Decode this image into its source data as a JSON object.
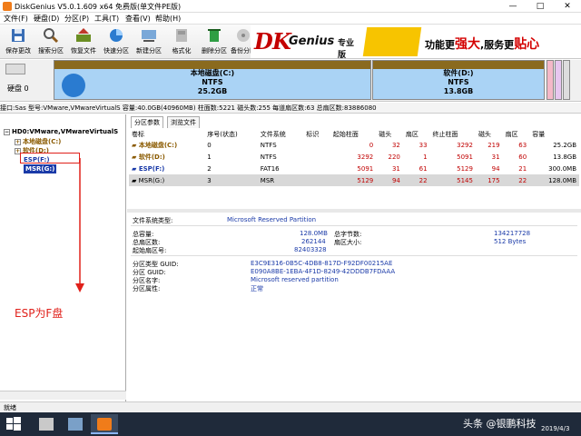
{
  "window": {
    "title": "DiskGenius V5.0.1.609 x64 免费版(单文件PE版)",
    "min": "—",
    "max": "□",
    "close": "✕"
  },
  "menu": [
    "文件(F)",
    "硬盘(D)",
    "分区(P)",
    "工具(T)",
    "查看(V)",
    "帮助(H)"
  ],
  "toolbar": {
    "items": [
      {
        "label": "保存更改",
        "icon": "save-icon"
      },
      {
        "label": "搜索分区",
        "icon": "search-icon"
      },
      {
        "label": "恢复文件",
        "icon": "recover-icon"
      },
      {
        "label": "快速分区",
        "icon": "quick-partition-icon"
      },
      {
        "label": "新建分区",
        "icon": "new-partition-icon"
      },
      {
        "label": "格式化",
        "icon": "format-icon"
      },
      {
        "label": "删除分区",
        "icon": "delete-icon"
      },
      {
        "label": "备份分区",
        "icon": "backup-icon"
      }
    ]
  },
  "banner": {
    "brand_a": "D",
    "brand_b": "K",
    "brand_name": "Genius",
    "brand_tag": "专业版",
    "slogan_a": "功能更",
    "slogan_b": "强大",
    "slogan_c": ",服务更",
    "slogan_d": "贴心"
  },
  "disk_map": {
    "label": "硬盘 0",
    "partitions": [
      {
        "name": "本地磁盘(C:)",
        "fs": "NTFS",
        "size": "25.2GB"
      },
      {
        "name": "软件(D:)",
        "fs": "NTFS",
        "size": "13.8GB"
      }
    ]
  },
  "info_line": "接口:Sas  型号:VMware,VMwareVirtualS  容量:40.0GB(40960MB)  柱面数:5221  磁头数:255  每道扇区数:63  总扇区数:83886080",
  "tree": {
    "disk": "HD0:VMware,VMwareVirtualS",
    "nodes": [
      "本地磁盘(C:)",
      "软件(D:)",
      "ESP(F:)",
      "MSR(G:)"
    ]
  },
  "tabs": [
    "分区参数",
    "浏览文件"
  ],
  "table": {
    "headers": [
      "卷标",
      "序号(状态)",
      "文件系统",
      "标识",
      "起始柱面",
      "磁头",
      "扇区",
      "终止柱面",
      "磁头",
      "扇区",
      "容量"
    ],
    "rows": [
      [
        "本地磁盘(C:)",
        "0",
        "NTFS",
        "",
        "0",
        "32",
        "33",
        "3292",
        "219",
        "63",
        "25.2GB"
      ],
      [
        "软件(D:)",
        "1",
        "NTFS",
        "",
        "3292",
        "220",
        "1",
        "5091",
        "31",
        "60",
        "13.8GB"
      ],
      [
        "ESP(F:)",
        "2",
        "FAT16",
        "",
        "5091",
        "31",
        "61",
        "5129",
        "94",
        "21",
        "300.0MB"
      ],
      [
        "MSR(G:)",
        "3",
        "MSR",
        "",
        "5129",
        "94",
        "22",
        "5145",
        "175",
        "22",
        "128.0MB"
      ]
    ]
  },
  "details": {
    "fs_type_label": "文件系统类型:",
    "fs_type_value": "Microsoft Reserved Partition",
    "total_cap_label": "总容量:",
    "total_cap_value": "128.0MB",
    "total_bytes_label": "总字节数:",
    "total_bytes_value": "134217728",
    "total_sec_label": "总扇区数:",
    "total_sec_value": "262144",
    "sec_size_label": "扇区大小:",
    "sec_size_value": "512 Bytes",
    "start_sec_label": "起始扇区号:",
    "start_sec_value": "82403328",
    "type_guid_label": "分区类型 GUID:",
    "type_guid_value": "E3C9E316-0B5C-4DB8-817D-F92DF00215AE",
    "guid_label": "分区 GUID:",
    "guid_value": "E090A8BE-1EBA-4F1D-8249-42DDDB7FDAAA",
    "name_label": "分区名字:",
    "name_value": "Microsoft reserved partition",
    "attr_label": "分区属性:",
    "attr_value": "正常"
  },
  "annotation": "ESP为F盘",
  "status": "就绪",
  "taskbar": {
    "watermark": "头条 @银鹏科技",
    "date": "2019/4/3"
  }
}
